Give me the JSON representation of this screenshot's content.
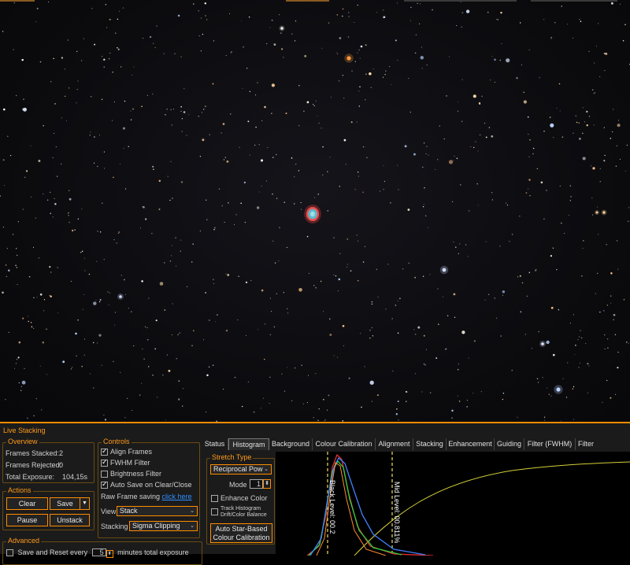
{
  "panel": {
    "title": "Live Stacking"
  },
  "overview": {
    "legend": "Overview",
    "frames_stacked_label": "Frames Stacked:",
    "frames_stacked_value": "2",
    "frames_rejected_label": "Frames Rejected:",
    "frames_rejected_value": "0",
    "total_exposure_label": "Total Exposure:",
    "total_exposure_value": "104,15s"
  },
  "actions": {
    "legend": "Actions",
    "clear": "Clear",
    "save": "Save",
    "pause": "Pause",
    "unstack": "Unstack"
  },
  "advanced": {
    "legend": "Advanced",
    "save_reset_label": "Save and Reset every",
    "save_reset_value": "5",
    "save_reset_suffix": "minutes total exposure"
  },
  "controls": {
    "legend": "Controls",
    "align_frames": "Align Frames",
    "fwhm_filter": "FWHM Filter",
    "brightness_filter": "Brightness Filter",
    "auto_save": "Auto Save on Clear/Close",
    "raw_frame_label": "Raw Frame saving",
    "raw_frame_link": "click here",
    "view_label": "View",
    "view_value": "Stack",
    "stacking_label": "Stacking",
    "stacking_value": "Sigma Clipping"
  },
  "tabs": [
    "Status",
    "Histogram",
    "Background",
    "Colour Calibration",
    "Alignment",
    "Stacking",
    "Enhancement",
    "Guiding",
    "Filter (FWHM)",
    "Filter (Brightness"
  ],
  "stretch": {
    "legend": "Stretch Type",
    "type_value": "Reciprocal Pow",
    "mode_label": "Mode",
    "mode_value": "1",
    "enhance_color": "Enhance Color",
    "track_histogram": "Track Histogram Drift/Color Balance",
    "auto_star_button": "Auto Star-Based Colour Calibration"
  },
  "histogram": {
    "black_level_label": "Black Level: 00.2",
    "mid_level_label": "Mid Level: 00.811%"
  },
  "colors": {
    "accent": "#ff8c00",
    "link": "#2f8fff",
    "nebula": "#e24040"
  }
}
